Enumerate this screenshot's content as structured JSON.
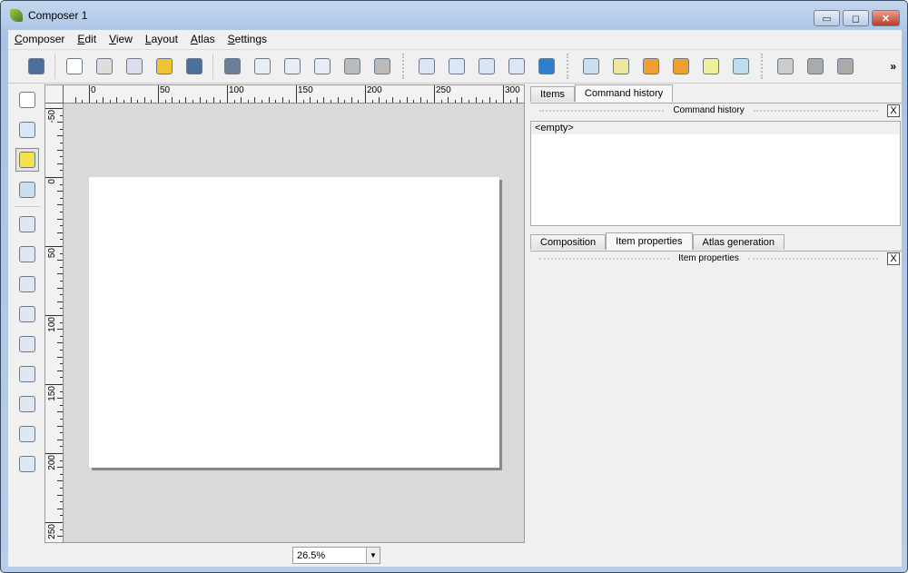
{
  "window": {
    "title": "Composer 1",
    "minimize": "▭",
    "restore": "◻",
    "close": "✕"
  },
  "menu": [
    "Composer",
    "Edit",
    "View",
    "Layout",
    "Atlas",
    "Settings"
  ],
  "toolbar": {
    "overflow": "»",
    "icons": [
      "save-icon",
      "new-composer-icon",
      "duplicate-composer-icon",
      "composer-manager-icon",
      "open-template-icon",
      "save-template-icon",
      "print-icon",
      "export-image-icon",
      "export-svg-icon",
      "export-pdf-icon",
      "undo-icon",
      "redo-icon",
      "zoom-full-icon",
      "zoom-actual-icon",
      "zoom-in-icon",
      "zoom-out-icon",
      "refresh-icon",
      "select-all-icon",
      "deselect-icon",
      "lock-icon",
      "unlock-icon",
      "raise-lower-icon",
      "align-icon",
      "atlas-preview-icon",
      "first-feature-icon",
      "previous-feature-icon"
    ]
  },
  "left_toolbar": [
    "pan-icon",
    "zoom-tool-icon",
    "select-move-item-icon",
    "move-content-icon",
    "add-map-icon",
    "add-image-icon",
    "add-label-icon",
    "add-legend-icon",
    "add-scalebar-icon",
    "add-shape-icon",
    "add-arrow-icon",
    "add-table-icon",
    "add-html-icon"
  ],
  "rulers": {
    "horizontal": [
      "0",
      "50",
      "100",
      "150",
      "200",
      "250",
      "300"
    ],
    "vertical": [
      "-50",
      "0",
      "50",
      "100",
      "150",
      "200",
      "250"
    ]
  },
  "zoom": {
    "value": "26.5%",
    "arrow": "▼"
  },
  "top_dock": {
    "tabs": [
      "Items",
      "Command history"
    ],
    "active": 1,
    "header": "Command history",
    "close": "X",
    "list": [
      "<empty>"
    ]
  },
  "bottom_dock": {
    "tabs": [
      "Composition",
      "Item properties",
      "Atlas generation"
    ],
    "active": 1,
    "header": "Item properties",
    "close": "X"
  }
}
